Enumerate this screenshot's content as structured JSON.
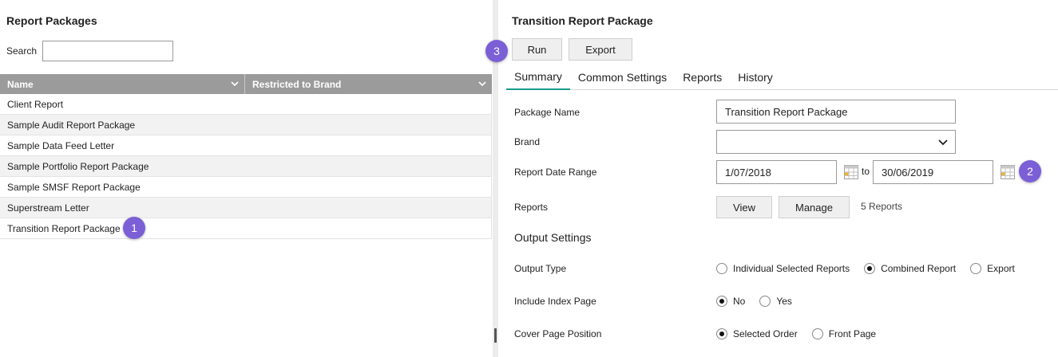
{
  "left": {
    "title": "Report Packages",
    "search_label": "Search",
    "search_value": "",
    "columns": [
      "Name",
      "Restricted to Brand"
    ],
    "rows": [
      "Client Report",
      "Sample Audit Report Package",
      "Sample Data Feed Letter",
      "Sample Portfolio Report Package",
      "Sample SMSF Report Package",
      "Superstream Letter",
      "Transition Report Package"
    ],
    "badge": "1"
  },
  "right": {
    "title": "Transition Report Package",
    "run_label": "Run",
    "export_label": "Export",
    "badge_run": "3",
    "tabs": [
      "Summary",
      "Common Settings",
      "Reports",
      "History"
    ],
    "package_name_label": "Package Name",
    "package_name_value": "Transition Report Package",
    "brand_label": "Brand",
    "brand_value": "",
    "date_range_label": "Report Date Range",
    "date_from": "1/07/2018",
    "date_to_sep": "to",
    "date_to": "30/06/2019",
    "badge_date": "2",
    "reports_label": "Reports",
    "view_label": "View",
    "manage_label": "Manage",
    "reports_count": "5 Reports",
    "output_settings_title": "Output Settings",
    "output_type_label": "Output Type",
    "output_type_options": [
      "Individual Selected Reports",
      "Combined Report",
      "Export"
    ],
    "output_type_selected": "Combined Report",
    "index_page_label": "Include Index Page",
    "index_page_options": [
      "No",
      "Yes"
    ],
    "index_page_selected": "No",
    "cover_page_label": "Cover Page Position",
    "cover_page_options": [
      "Selected Order",
      "Front Page"
    ],
    "cover_page_selected": "Selected Order"
  },
  "colors": {
    "header_grey": "#9b9b9b",
    "badge_purple": "#7b5fd6",
    "tab_active": "#1a9c8c"
  }
}
